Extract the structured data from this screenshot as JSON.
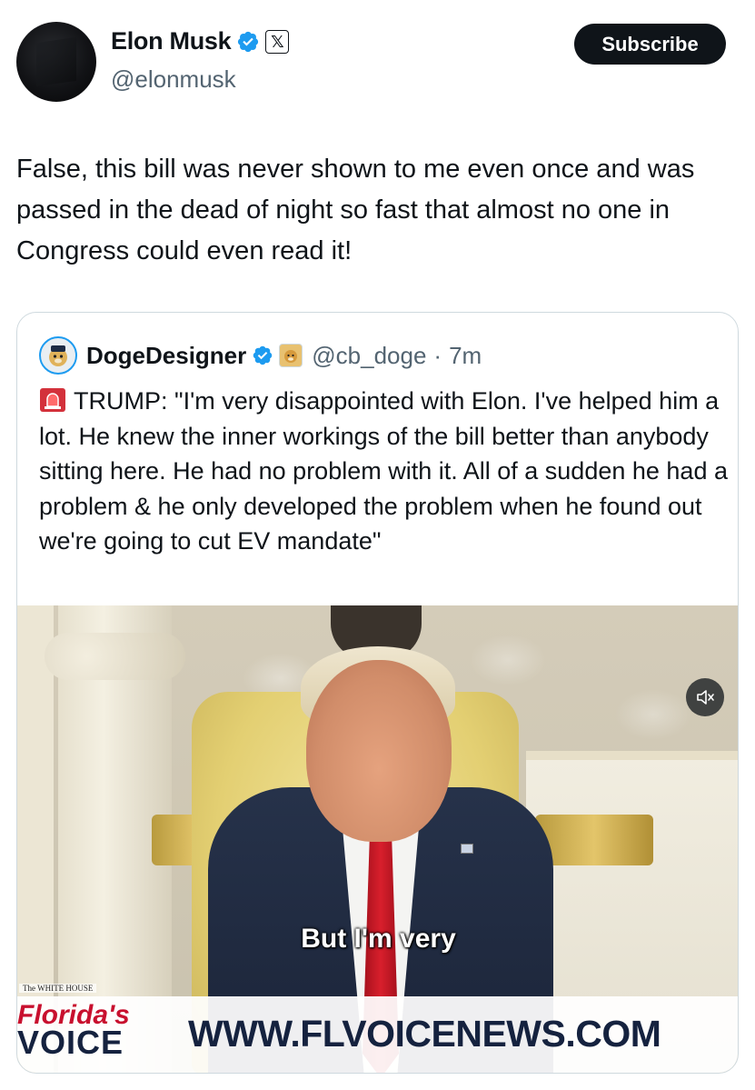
{
  "author": {
    "display_name": "Elon Musk",
    "handle": "@elonmusk"
  },
  "actions": {
    "subscribe_label": "Subscribe"
  },
  "tweet": {
    "text": "False, this bill was never shown to me even once and was passed in the dead of night so fast that almost no one in Congress could even read it!"
  },
  "quoted_tweet": {
    "display_name": "DogeDesigner",
    "handle": "@cb_doge",
    "separator": "·",
    "time": "7m",
    "text": "TRUMP: \"I'm very disappointed with Elon. I've helped him a lot. He knew the inner workings of the bill better than anybody sitting here. He had no problem with it. All of a sudden he had a problem & he only developed the problem when he found out we're going to cut EV mandate\"",
    "video": {
      "caption": "But I'm very",
      "source_tag": "The WHITE HOUSE",
      "logo_line1": "Florida's",
      "logo_line2": "VOICE",
      "url_banner": "WWW.FLVOICENEWS.COM"
    }
  },
  "colors": {
    "verified_blue": "#1d9bf0",
    "text_primary": "#0f1419",
    "text_secondary": "#536471",
    "border": "#cfd9de"
  },
  "icons": {
    "verified": "verified-checkmark-icon",
    "x_badge": "x-logo-icon",
    "doge_badge": "doge-affiliate-icon",
    "siren": "police-light-icon",
    "mute": "speaker-muted-icon"
  }
}
